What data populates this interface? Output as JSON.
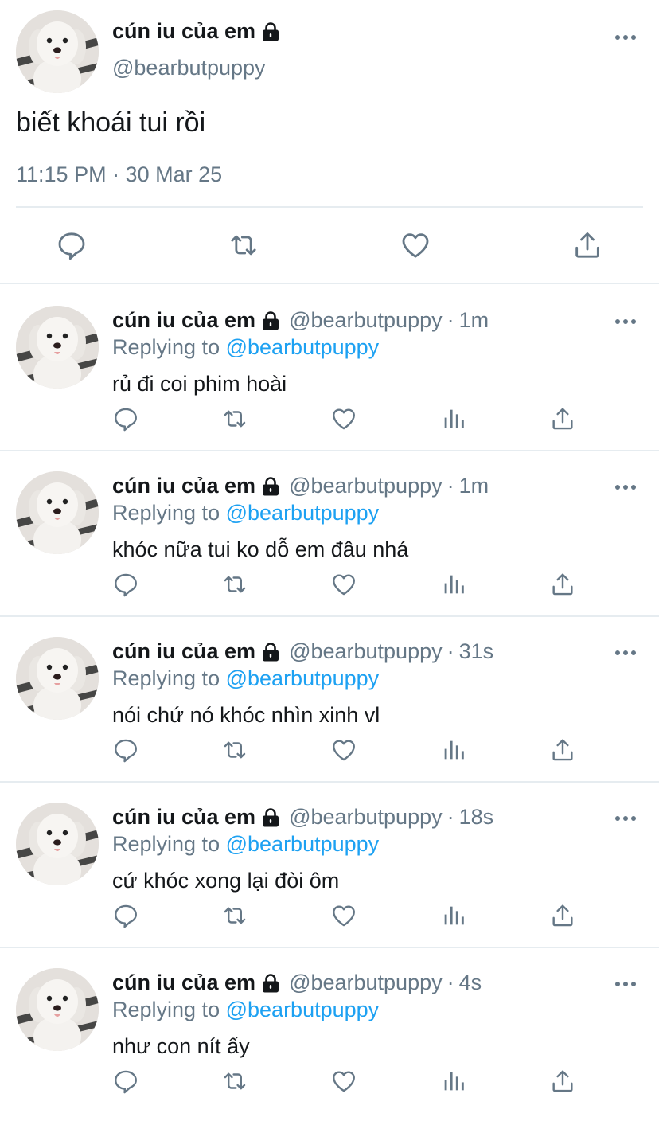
{
  "colors": {
    "text": "#14171a",
    "secondary": "#657786",
    "accent": "#1da1f2",
    "icon": "#657786",
    "divider": "#e6ecf0"
  },
  "main_tweet": {
    "display_name": "cún iu của em",
    "handle": "@bearbutpuppy",
    "text": "biết khoái tui rồi",
    "timestamp": "11:15 PM · 30 Mar 25",
    "icons": [
      "more-icon",
      "lock-icon",
      "reply-icon",
      "retweet-icon",
      "like-icon",
      "share-icon"
    ]
  },
  "replies": [
    {
      "display_name": "cún iu của em",
      "handle": "@bearbutpuppy",
      "time": "1m",
      "replying_label": "Replying to",
      "replying_to": "@bearbutpuppy",
      "text": "rủ đi coi phim hoài"
    },
    {
      "display_name": "cún iu của em",
      "handle": "@bearbutpuppy",
      "time": "1m",
      "replying_label": "Replying to",
      "replying_to": "@bearbutpuppy",
      "text": "khóc nữa tui ko dỗ em đâu nhá"
    },
    {
      "display_name": "cún iu của em",
      "handle": "@bearbutpuppy",
      "time": "31s",
      "replying_label": "Replying to",
      "replying_to": "@bearbutpuppy",
      "text": "nói chứ nó khóc nhìn xinh vl"
    },
    {
      "display_name": "cún iu của em",
      "handle": "@bearbutpuppy",
      "time": "18s",
      "replying_label": "Replying to",
      "replying_to": "@bearbutpuppy",
      "text": "cứ khóc xong lại đòi ôm"
    },
    {
      "display_name": "cún iu của em",
      "handle": "@bearbutpuppy",
      "time": "4s",
      "replying_label": "Replying to",
      "replying_to": "@bearbutpuppy",
      "text": "như con nít ấy"
    }
  ],
  "reply_action_icons": [
    "reply-icon",
    "retweet-icon",
    "like-icon",
    "analytics-icon",
    "share-icon"
  ]
}
